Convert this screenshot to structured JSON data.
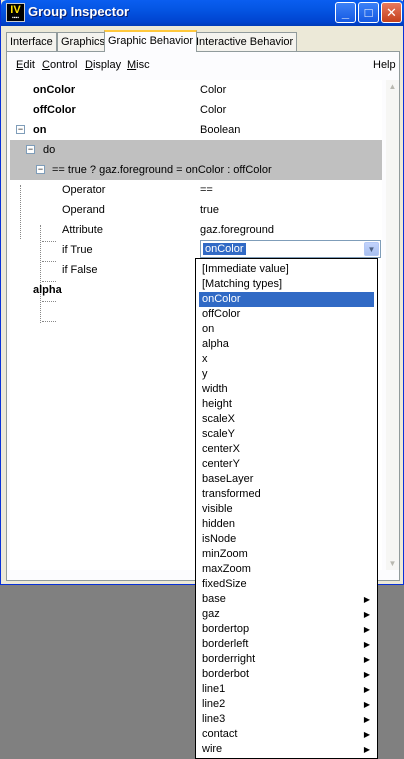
{
  "window": {
    "title": "Group Inspector",
    "logo_text": "IV",
    "title_buttons": [
      {
        "name": "minimize-button",
        "glyph": "_"
      },
      {
        "name": "maximize-button",
        "glyph": "□"
      },
      {
        "name": "close-button",
        "glyph": "✕"
      }
    ]
  },
  "tabs": [
    "Interface",
    "Graphics",
    "Graphic Behavior",
    "Interactive Behavior"
  ],
  "active_tab": "Graphic Behavior",
  "menu": {
    "items": [
      {
        "label": "Edit",
        "mnemonic": "E"
      },
      {
        "label": "Control",
        "mnemonic": "C"
      },
      {
        "label": "Display",
        "mnemonic": "D"
      },
      {
        "label": "Misc",
        "mnemonic": "M"
      }
    ],
    "help": "Help"
  },
  "tree": {
    "onColor": {
      "name": "onColor",
      "type": "Color"
    },
    "offColor": {
      "name": "offColor",
      "type": "Color"
    },
    "on": {
      "name": "on",
      "type": "Boolean"
    },
    "do": {
      "name": "do"
    },
    "expression": {
      "name": "== true ? gaz.foreground = onColor : offColor"
    },
    "operator": {
      "name": "Operator",
      "value": "=="
    },
    "operand": {
      "name": "Operand",
      "value": "true"
    },
    "attribute": {
      "name": "Attribute",
      "value": "gaz.foreground"
    },
    "if_true": {
      "name": "if True",
      "value": "onColor"
    },
    "if_false": {
      "name": "if False"
    },
    "alpha": {
      "name": "alpha"
    }
  },
  "expand_glyph": "−",
  "dropdown_glyph": "▼",
  "submenu_glyph": "▶",
  "scroll_glyphs": {
    "up": "▲",
    "down": "▼"
  },
  "dropdown": {
    "selected": "onColor",
    "options": [
      {
        "label": "[Immediate value]"
      },
      {
        "label": "[Matching types]"
      },
      {
        "label": "onColor"
      },
      {
        "label": "offColor"
      },
      {
        "label": "on"
      },
      {
        "label": "alpha"
      },
      {
        "label": "x"
      },
      {
        "label": "y"
      },
      {
        "label": "width"
      },
      {
        "label": "height"
      },
      {
        "label": "scaleX"
      },
      {
        "label": "scaleY"
      },
      {
        "label": "centerX"
      },
      {
        "label": "centerY"
      },
      {
        "label": "baseLayer"
      },
      {
        "label": "transformed"
      },
      {
        "label": "visible"
      },
      {
        "label": "hidden"
      },
      {
        "label": "isNode"
      },
      {
        "label": "minZoom"
      },
      {
        "label": "maxZoom"
      },
      {
        "label": "fixedSize"
      },
      {
        "label": "base",
        "submenu": true
      },
      {
        "label": "gaz",
        "submenu": true
      },
      {
        "label": "bordertop",
        "submenu": true
      },
      {
        "label": "borderleft",
        "submenu": true
      },
      {
        "label": "borderright",
        "submenu": true
      },
      {
        "label": "borderbot",
        "submenu": true
      },
      {
        "label": "line1",
        "submenu": true
      },
      {
        "label": "line2",
        "submenu": true
      },
      {
        "label": "line3",
        "submenu": true
      },
      {
        "label": "contact",
        "submenu": true
      },
      {
        "label": "wire",
        "submenu": true
      }
    ]
  },
  "colors": {
    "titlebar": "#0454e2",
    "selection": "#316ac5",
    "tree_highlight": "#c0c0c0",
    "desktop": "#808080"
  }
}
